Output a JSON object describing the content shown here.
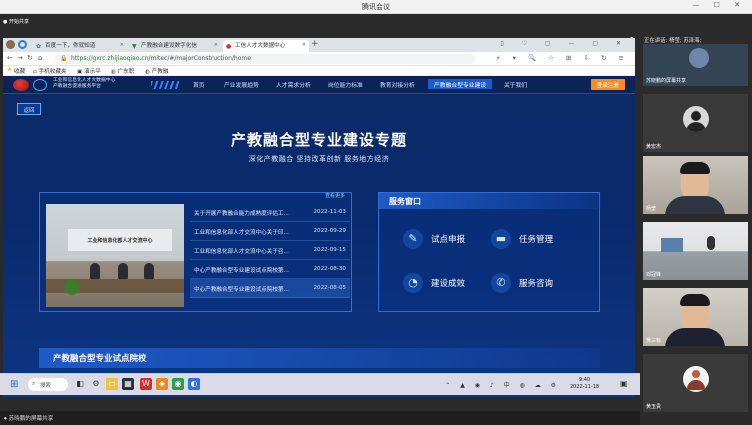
{
  "meeting": {
    "window_title": "腾讯会议",
    "screen_share_label": "开始共享",
    "sharer_label": "苏晓鹏的屏幕共享",
    "speaking_label": "正在讲话: 杨莹; 苏泽海;"
  },
  "browser": {
    "tabs": [
      {
        "label": "百度一下，你就知道",
        "icon": "baidu-paw-icon"
      },
      {
        "label": "产教融合建设数字化信",
        "icon": "shield-icon"
      },
      {
        "label": "工信人才大数据中心",
        "icon": "red-circle-icon"
      }
    ],
    "url_host": "https://gxrc.zhijiaoqiao.cn",
    "url_path": "/mitec/#/majorConstruction/home",
    "bookmarks": [
      "收藏",
      "手机收藏夹",
      "演示平",
      "广东职",
      "产教融"
    ]
  },
  "site": {
    "name_line1": "工业和信息化人才大数据中心",
    "name_line2": "产教融合促进服务平台",
    "nav": [
      "首页",
      "产业发展趋势",
      "人才需求分析",
      "岗位能力标准",
      "教育对接分析",
      "产教融合型专业建设",
      "关于我们"
    ],
    "active_nav": "产教融合型专业建设",
    "login_label": "登录注册",
    "back_label": "返回",
    "hero_title": "产教融合型专业建设专题",
    "hero_subtitle": "深化产教融合 坚持改革创新 服务地方经济",
    "news_more": "查看更多",
    "photo_banner": "工业和信息化部人才交流中心",
    "news": [
      {
        "title": "关于开展产教融合能力成熟度评估工...",
        "date": "2022-11-03"
      },
      {
        "title": "工业和信息化部人才交流中心关于印...",
        "date": "2022-09-29"
      },
      {
        "title": "工业和信息化部人才交流中心关于召...",
        "date": "2022-09-15"
      },
      {
        "title": "中心产教融合型专业建设试点院校第...",
        "date": "2022-08-30"
      },
      {
        "title": "中心产教融合型专业建设试点院校第...",
        "date": "2022-08-05"
      }
    ],
    "service_title": "服务窗口",
    "services": [
      {
        "label": "试点申报",
        "icon": "apply-icon"
      },
      {
        "label": "任务管理",
        "icon": "task-icon"
      },
      {
        "label": "建设成效",
        "icon": "pie-icon"
      },
      {
        "label": "服务咨询",
        "icon": "phone-icon"
      }
    ],
    "pilot_title": "产教融合型专业试点院校"
  },
  "taskbar": {
    "search_label": "搜索",
    "time": "9:40",
    "date": "2022-11-18",
    "lang": "中"
  },
  "participants": [
    {
      "name": "苏晓鹏的屏幕共享",
      "type": "share"
    },
    {
      "name": "黄宏杰",
      "type": "avatar"
    },
    {
      "name": "杨莹",
      "type": "video"
    },
    {
      "name": "邓冠锋",
      "type": "video-room"
    },
    {
      "name": "黄三标",
      "type": "video"
    },
    {
      "name": "黄玉贵",
      "type": "avatar"
    }
  ],
  "colors": {
    "page_bg": "#0b2a66",
    "accent": "#1d5bd0",
    "login": "#ff8a1f"
  }
}
